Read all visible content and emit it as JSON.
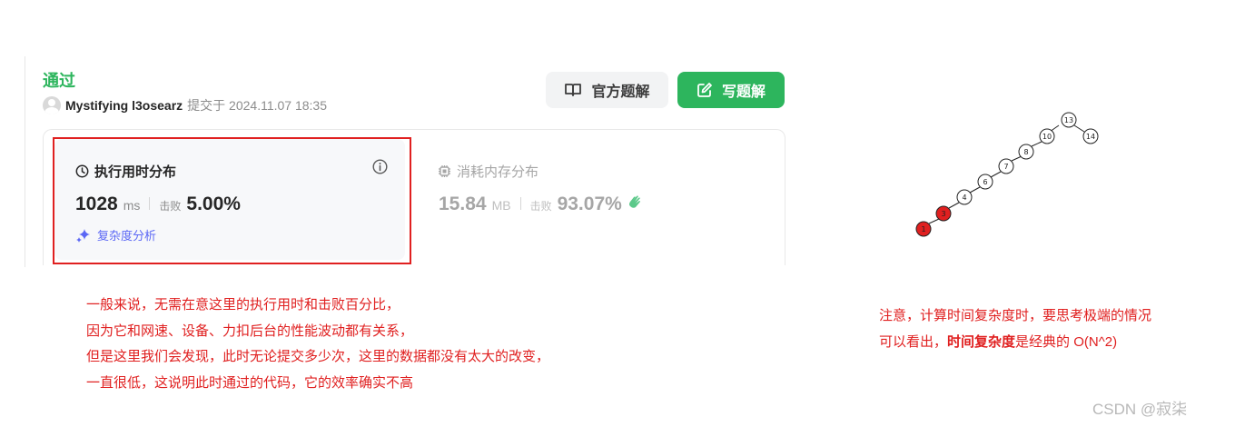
{
  "submission": {
    "status": "通过",
    "user": "Mystifying l3osearz",
    "submitted_at": "提交于 2024.11.07 18:35"
  },
  "buttons": {
    "official_solution": "官方题解",
    "write_solution": "写题解"
  },
  "runtime": {
    "title": "执行用时分布",
    "value": "1028",
    "unit": "ms",
    "beat_label": "击败",
    "beat_percent": "5.00%",
    "complexity_link": "复杂度分析"
  },
  "memory": {
    "title": "消耗内存分布",
    "value": "15.84",
    "unit": "MB",
    "beat_label": "击败",
    "beat_percent": "93.07%"
  },
  "tree_nodes": [
    "1",
    "3",
    "4",
    "6",
    "7",
    "8",
    "10",
    "13",
    "14"
  ],
  "annotation_left": {
    "lines": [
      "一般来说，无需在意这里的执行用时和击败百分比，",
      "因为它和网速、设备、力扣后台的性能波动都有关系，",
      "但是这里我们会发现，此时无论提交多少次，这里的数据都没有太大的改变，",
      "一直很低，这说明此时通过的代码，它的效率确实不高"
    ]
  },
  "annotation_right": {
    "line1": "注意，计算时间复杂度时，要思考极端的情况",
    "line2_prefix": "可以看出，",
    "line2_bold": "时间复杂度",
    "line2_suffix": "是经典的 O(N^2)"
  },
  "watermark": "CSDN @寂柒",
  "colors": {
    "accepted": "#2db55d",
    "highlight": "#e02020",
    "link": "#5b67f5",
    "annotation": "#e02020"
  }
}
